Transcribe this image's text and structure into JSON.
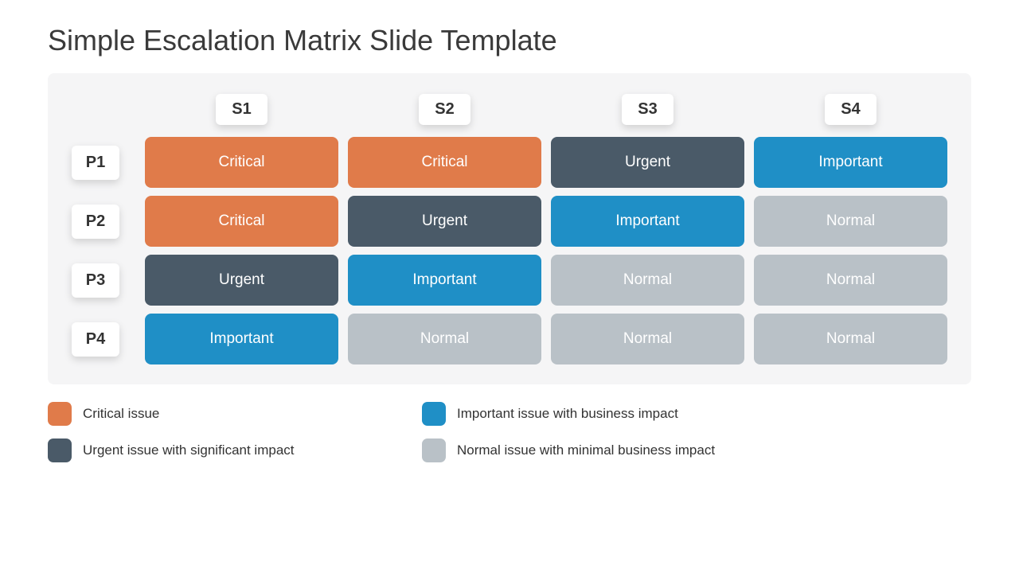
{
  "title": "Simple Escalation Matrix Slide Template",
  "columns": [
    "S1",
    "S2",
    "S3",
    "S4"
  ],
  "rows": [
    "P1",
    "P2",
    "P3",
    "P4"
  ],
  "cells": [
    [
      {
        "label": "Critical",
        "type": "critical"
      },
      {
        "label": "Critical",
        "type": "critical"
      },
      {
        "label": "Urgent",
        "type": "urgent"
      },
      {
        "label": "Important",
        "type": "important"
      }
    ],
    [
      {
        "label": "Critical",
        "type": "critical"
      },
      {
        "label": "Urgent",
        "type": "urgent"
      },
      {
        "label": "Important",
        "type": "important"
      },
      {
        "label": "Normal",
        "type": "normal"
      }
    ],
    [
      {
        "label": "Urgent",
        "type": "urgent"
      },
      {
        "label": "Important",
        "type": "important"
      },
      {
        "label": "Normal",
        "type": "normal"
      },
      {
        "label": "Normal",
        "type": "normal"
      }
    ],
    [
      {
        "label": "Important",
        "type": "important"
      },
      {
        "label": "Normal",
        "type": "normal"
      },
      {
        "label": "Normal",
        "type": "normal"
      },
      {
        "label": "Normal",
        "type": "normal"
      }
    ]
  ],
  "legend": [
    {
      "text": "Critical issue",
      "type": "critical"
    },
    {
      "text": "Important issue with business impact",
      "type": "important"
    },
    {
      "text": "Urgent issue with significant impact",
      "type": "urgent"
    },
    {
      "text": "Normal issue with minimal business impact",
      "type": "normal"
    }
  ],
  "colors": {
    "critical": "#e07b4a",
    "urgent": "#4a5a68",
    "important": "#1f8fc6",
    "normal": "#b9c1c7"
  }
}
